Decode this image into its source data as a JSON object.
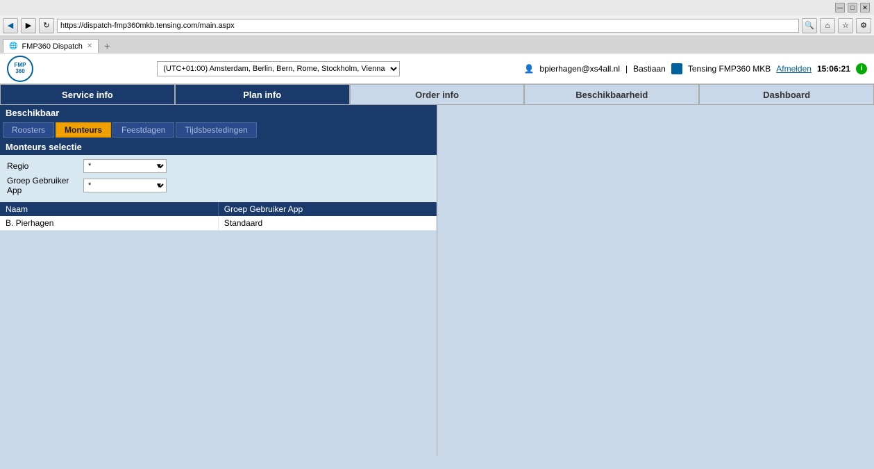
{
  "browser": {
    "address": "https://dispatch-fmp360mkb.tensing.com/main.aspx",
    "search_placeholder": "Search",
    "tab_title": "FMP360 Dispatch",
    "back_icon": "◀",
    "forward_icon": "▶",
    "refresh_icon": "↻",
    "home_icon": "⌂",
    "star_icon": "☆",
    "settings_icon": "⚙",
    "new_tab_icon": "+",
    "tab_close_icon": "✕",
    "min_icon": "—",
    "max_icon": "□",
    "close_icon": "✕"
  },
  "app": {
    "logo_text": "FMP\n360",
    "timezone": "(UTC+01:00) Amsterdam, Berlin, Bern, Rome, Stockholm, Vienna",
    "user_email": "bpierhagen@xs4all.nl",
    "user_separator": "|",
    "user_name": "Bastiaan",
    "company_name": "Tensing FMP360 MKB",
    "logout_label": "Afmelden",
    "time": "15:06:21",
    "info_icon": "i"
  },
  "main_nav": {
    "tabs": [
      {
        "label": "Service info",
        "state": "active"
      },
      {
        "label": "Plan info",
        "state": "active"
      },
      {
        "label": "Order info",
        "state": "light"
      },
      {
        "label": "Beschikbaarheid",
        "state": "light"
      },
      {
        "label": "Dashboard",
        "state": "light"
      }
    ]
  },
  "beschikbaar": {
    "section_title": "Beschikbaar",
    "sub_tabs": [
      {
        "label": "Roosters",
        "state": "inactive"
      },
      {
        "label": "Monteurs",
        "state": "active"
      },
      {
        "label": "Feestdagen",
        "state": "inactive"
      },
      {
        "label": "Tijdsbestedingen",
        "state": "inactive"
      }
    ]
  },
  "monteurs_selectie": {
    "title": "Monteurs selectie",
    "regio_label": "Regio",
    "regio_value": "*",
    "regio_options": [
      "*"
    ],
    "groep_label": "Groep Gebruiker\nApp",
    "groep_value": "*",
    "groep_options": [
      "*"
    ],
    "table_col_naam": "Naam",
    "table_col_groep": "Groep Gebruiker App",
    "rows": [
      {
        "naam": "B. Pierhagen",
        "groep": "Standaard"
      }
    ]
  }
}
